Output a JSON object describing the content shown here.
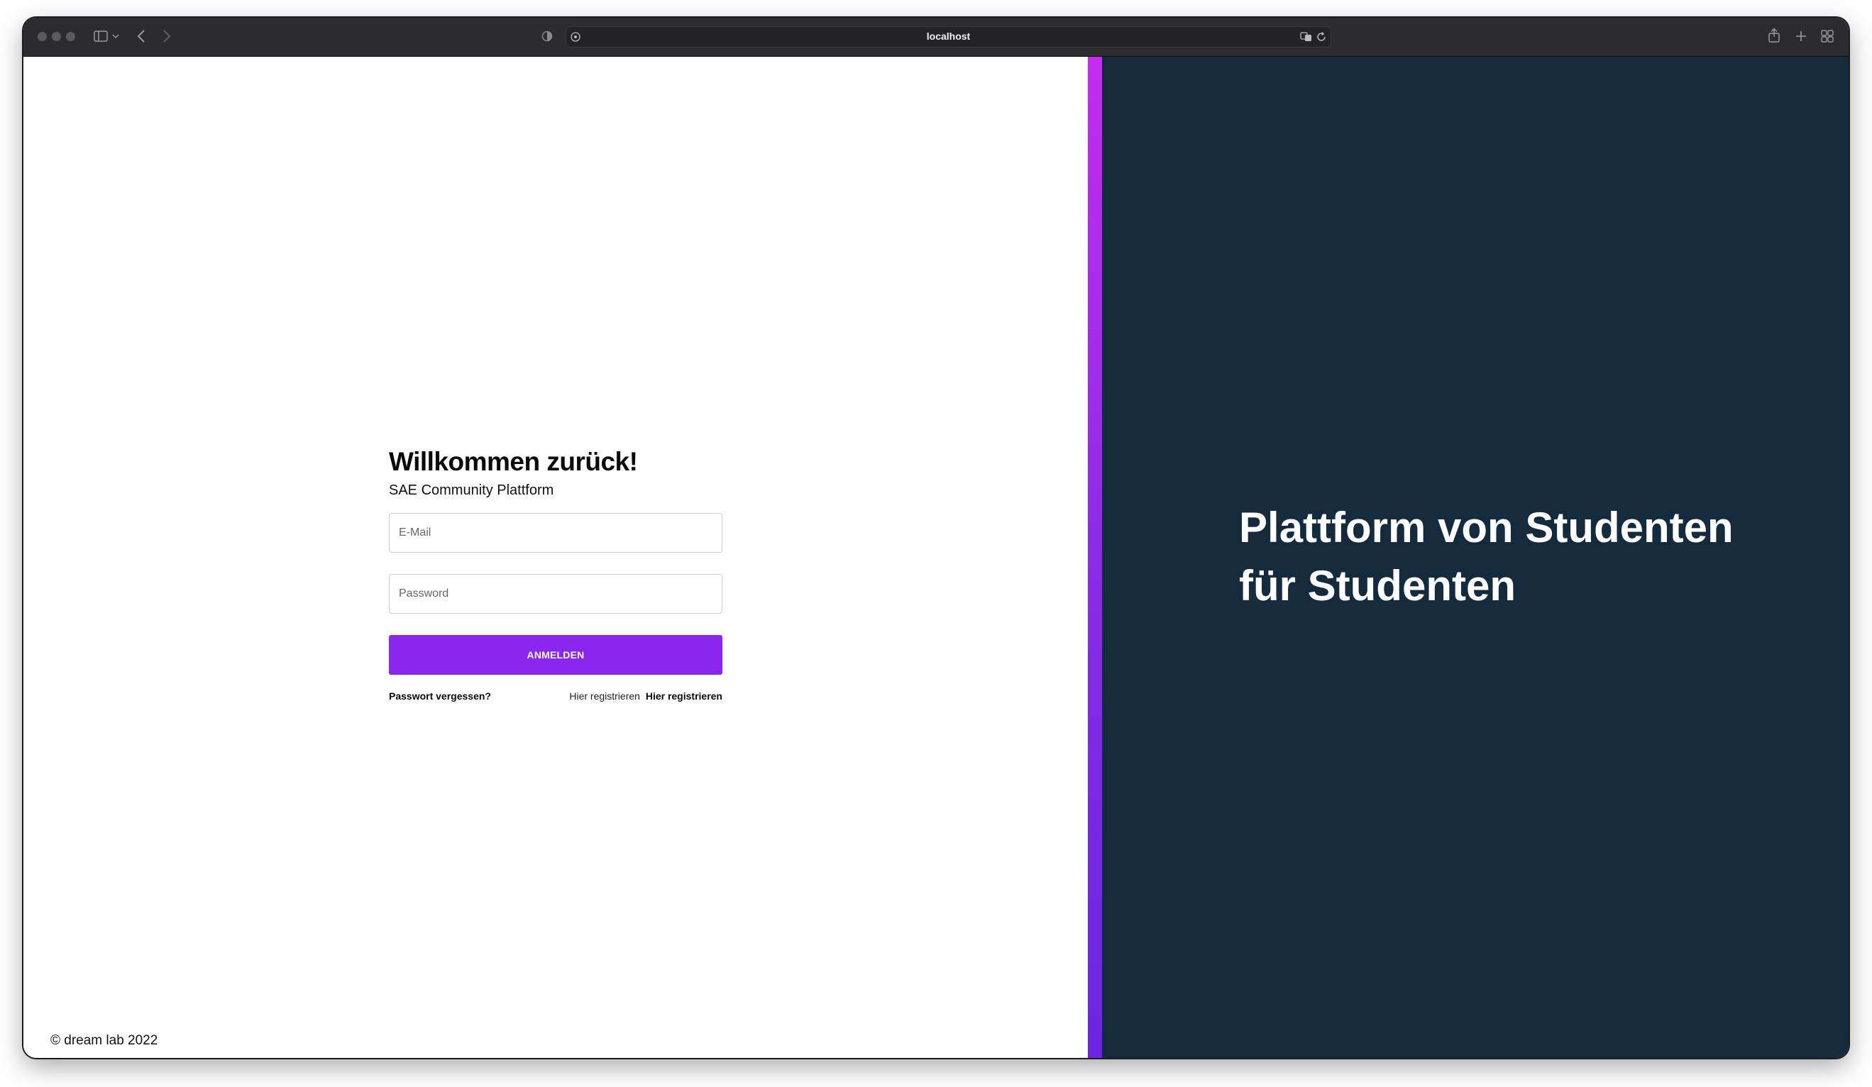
{
  "browser": {
    "url": "localhost"
  },
  "login": {
    "title": "Willkommen zurück!",
    "subtitle": "SAE Community Plattform",
    "email_placeholder": "E-Mail",
    "password_placeholder": "Password",
    "submit_label": "ANMELDEN",
    "forgot_label": "Passwort vergessen?",
    "register_prompt": "Hier registrieren",
    "register_link": "Hier registrieren"
  },
  "footer": {
    "copyright": "© dream lab 2022"
  },
  "hero": {
    "line1": "Plattform von Studenten",
    "line2": "für Studenten"
  },
  "colors": {
    "accent": "#8a26ee",
    "panel": "#142b3e",
    "gradient_top": "#c42bf0",
    "gradient_bottom": "#6a25e0"
  }
}
